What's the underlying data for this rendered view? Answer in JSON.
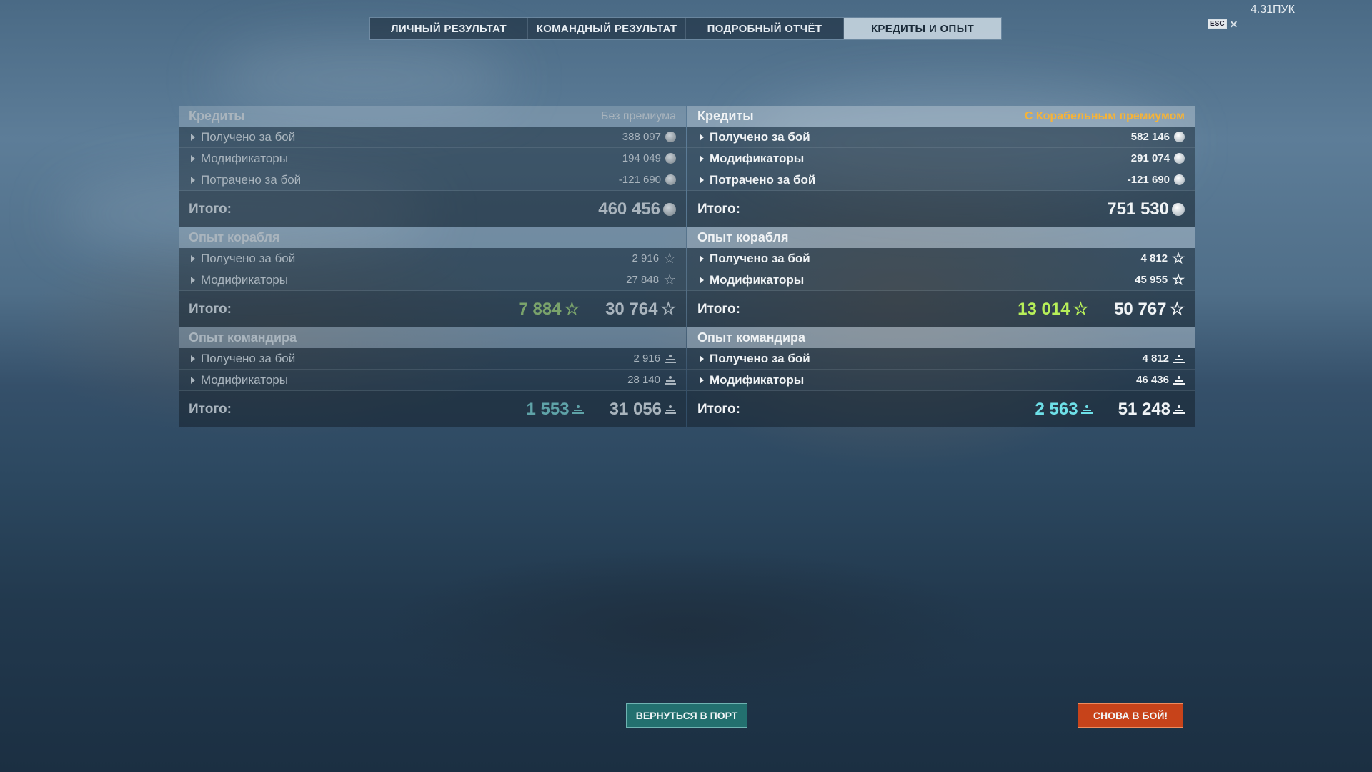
{
  "tabs": [
    {
      "label": "ЛИЧНЫЙ РЕЗУЛЬТАТ"
    },
    {
      "label": "КОМАНДНЫЙ РЕЗУЛЬТАТ"
    },
    {
      "label": "ПОДРОБНЫЙ ОТЧЁТ"
    },
    {
      "label": "КРЕДИТЫ И ОПЫТ"
    }
  ],
  "active_tab": "КРЕДИТЫ И ОПЫТ",
  "top_right_text": "4.31ПУК",
  "esc_label": "ESC",
  "left": {
    "credits": {
      "title": "Кредиты",
      "note": "Без премиума",
      "rows": [
        {
          "label": "Получено за бой",
          "value": "388 097"
        },
        {
          "label": "Модификаторы",
          "value": "194 049"
        },
        {
          "label": "Потрачено за бой",
          "value": "-121 690"
        }
      ],
      "total_label": "Итого:",
      "total": "460 456"
    },
    "ship_xp": {
      "title": "Опыт корабля",
      "rows": [
        {
          "label": "Получено за бой",
          "value": "2 916"
        },
        {
          "label": "Модификаторы",
          "value": "27 848"
        }
      ],
      "total_label": "Итого:",
      "total_free": "7 884",
      "total": "30 764"
    },
    "commander_xp": {
      "title": "Опыт командира",
      "rows": [
        {
          "label": "Получено за бой",
          "value": "2 916"
        },
        {
          "label": "Модификаторы",
          "value": "28 140"
        }
      ],
      "total_label": "Итого:",
      "total_free": "1 553",
      "total": "31 056"
    }
  },
  "right": {
    "credits": {
      "title": "Кредиты",
      "note": "С Корабельным премиумом",
      "rows": [
        {
          "label": "Получено за бой",
          "value": "582 146"
        },
        {
          "label": "Модификаторы",
          "value": "291 074"
        },
        {
          "label": "Потрачено за бой",
          "value": "-121 690"
        }
      ],
      "total_label": "Итого:",
      "total": "751 530"
    },
    "ship_xp": {
      "title": "Опыт корабля",
      "rows": [
        {
          "label": "Получено за бой",
          "value": "4 812"
        },
        {
          "label": "Модификаторы",
          "value": "45 955"
        }
      ],
      "total_label": "Итого:",
      "total_free": "13 014",
      "total": "50 767"
    },
    "commander_xp": {
      "title": "Опыт командира",
      "rows": [
        {
          "label": "Получено за бой",
          "value": "4 812"
        },
        {
          "label": "Модификаторы",
          "value": "46 436"
        }
      ],
      "total_label": "Итого:",
      "total_free": "2 563",
      "total": "51 248"
    }
  },
  "buttons": {
    "return_port": "ВЕРНУТЬСЯ В ПОРТ",
    "battle_again": "СНОВА В БОЙ!"
  },
  "colors": {
    "accent_premium": "#f5b338",
    "free_xp_green": "#b7ef59",
    "elite_commander_teal": "#6ee0e8",
    "port_button": "#23706f",
    "battle_button": "#c7431a"
  },
  "icons": {
    "credit": "credit-coin-icon",
    "ship_xp": "star-icon",
    "commander_xp": "commander-xp-icon",
    "row_expand": "triangle-right-icon"
  }
}
